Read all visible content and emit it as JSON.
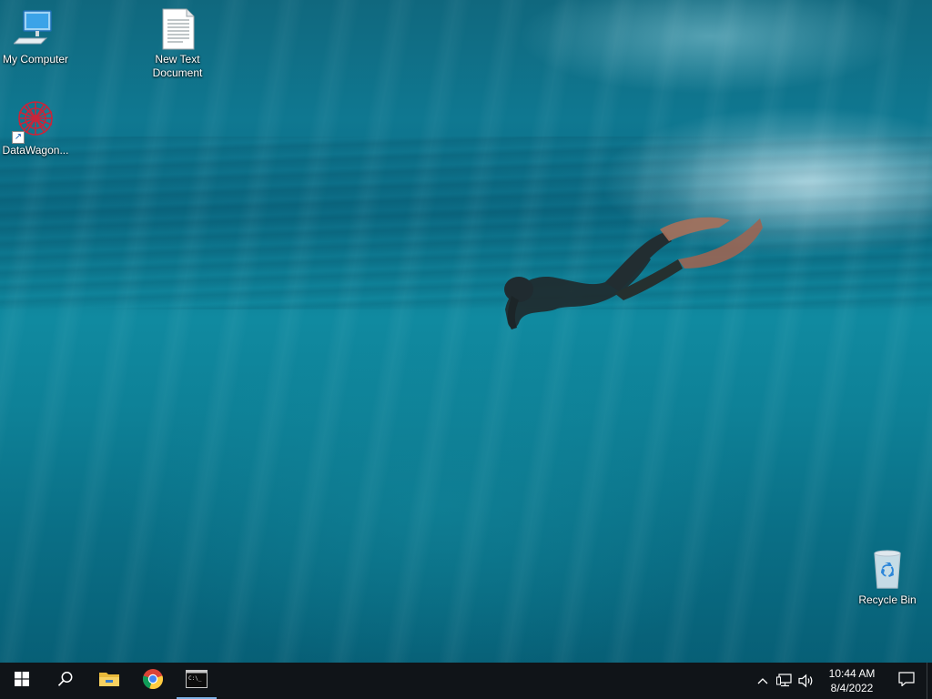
{
  "desktop": {
    "icons": [
      {
        "name": "my-computer",
        "label": "My Computer",
        "icon": "computer-icon"
      },
      {
        "name": "new-text-document",
        "label": "New Text Document",
        "icon": "text-document-icon"
      },
      {
        "name": "datawagon",
        "label": "DataWagon...",
        "icon": "datawagon-app-icon",
        "shortcut": true
      },
      {
        "name": "recycle-bin",
        "label": "Recycle Bin",
        "icon": "recycle-bin-icon"
      }
    ]
  },
  "taskbar": {
    "start": {
      "icon": "windows-start-icon"
    },
    "search": {
      "icon": "search-icon"
    },
    "pinned": [
      {
        "name": "file-explorer",
        "icon": "folder-icon",
        "active": false
      },
      {
        "name": "chrome",
        "icon": "chrome-icon",
        "active": false
      },
      {
        "name": "command-prompt",
        "icon": "terminal-icon",
        "active": true
      }
    ],
    "tray": {
      "icons": [
        "chevron-up-icon",
        "network-icon",
        "volume-icon"
      ],
      "time": "10:44 AM",
      "date": "8/4/2022",
      "notification_icon": "notification-icon"
    }
  },
  "colors": {
    "taskbar": "#101418",
    "active_indicator": "#7fb2e5",
    "water": "#0f7891"
  }
}
